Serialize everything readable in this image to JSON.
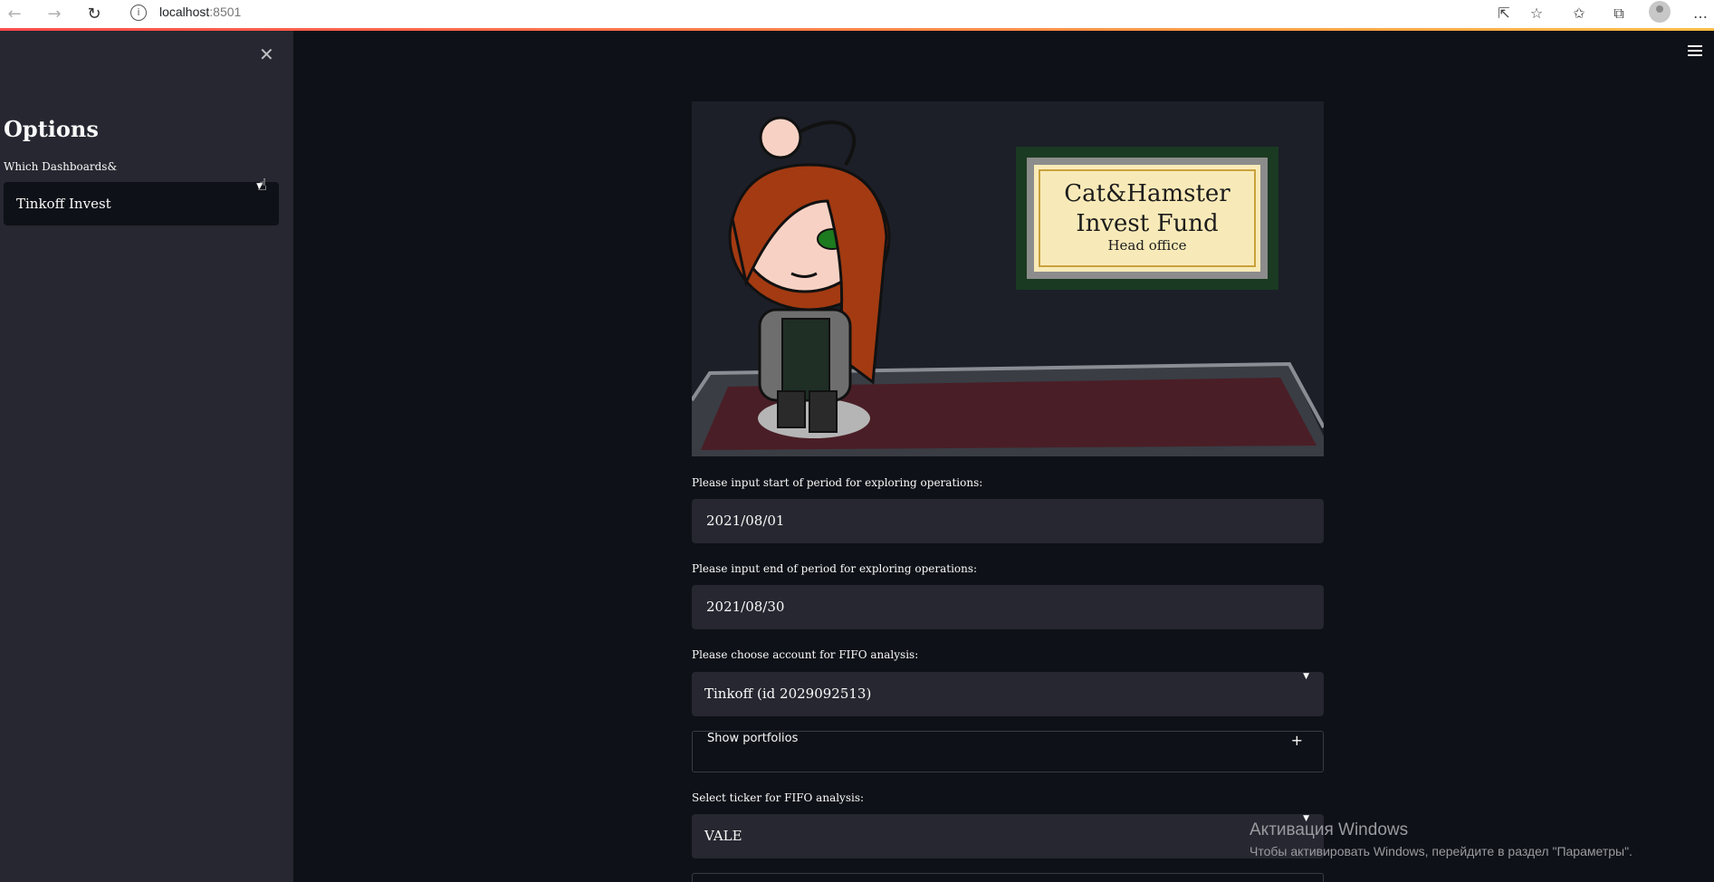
{
  "browser": {
    "url_host": "localhost",
    "url_port": ":8501"
  },
  "sidebar": {
    "close_icon": "close-icon",
    "title": "Options",
    "dashboards_label": "Which Dashboards&",
    "dashboards_value": "Tinkoff Invest"
  },
  "banner": {
    "sign_line1": "Cat&Hamster",
    "sign_line2": "Invest Fund",
    "sign_line3": "Head office"
  },
  "form": {
    "start_label": "Please input start of period for exploring operations:",
    "start_value": "2021/08/01",
    "end_label": "Please input end of period for exploring operations:",
    "end_value": "2021/08/30",
    "account_label": "Please choose account for FIFO analysis:",
    "account_value": "Tinkoff (id 2029092513)",
    "portfolios_label": "Show portfolios",
    "ticker_label": "Select ticker for FIFO analysis:",
    "ticker_value": "VALE"
  },
  "watermark": {
    "title": "Активация Windows",
    "subtitle": "Чтобы активировать Windows, перейдите в раздел \"Параметры\"."
  },
  "colors": {
    "background": "#0e1117",
    "sidebar": "#262730",
    "input": "#262730",
    "accent": "#ff4b4b"
  }
}
